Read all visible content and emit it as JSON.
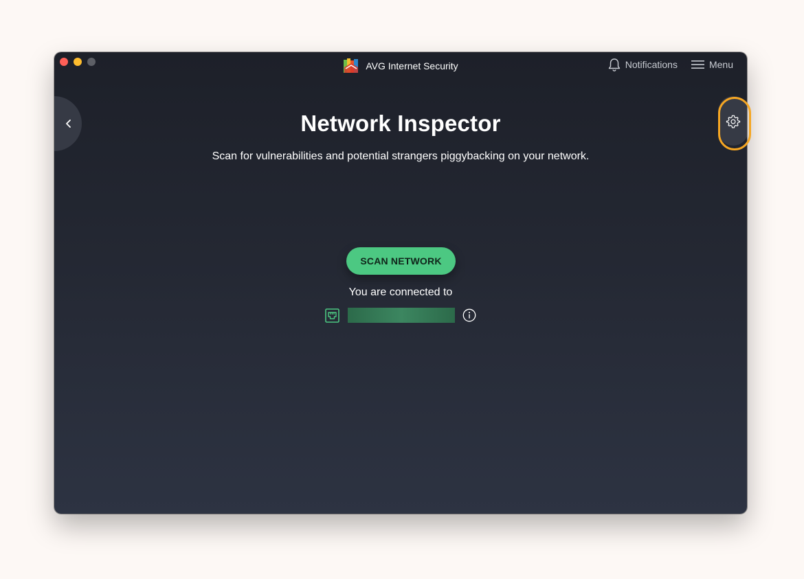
{
  "window": {
    "title": "AVG Internet Security"
  },
  "header": {
    "notifications_label": "Notifications",
    "menu_label": "Menu"
  },
  "main": {
    "title": "Network Inspector",
    "subtitle": "Scan for vulnerabilities and potential strangers piggybacking on your network.",
    "scan_button_label": "SCAN NETWORK",
    "connected_label": "You are connected to",
    "network_name_redacted": true
  },
  "icons": {
    "back": "chevron-left-icon",
    "settings": "gear-icon",
    "notifications": "bell-icon",
    "menu": "hamburger-icon",
    "network": "ethernet-icon",
    "info": "info-icon"
  },
  "colors": {
    "accent_green": "#4cc882",
    "highlight_orange": "#f5a623",
    "background_dark": "#242833"
  }
}
